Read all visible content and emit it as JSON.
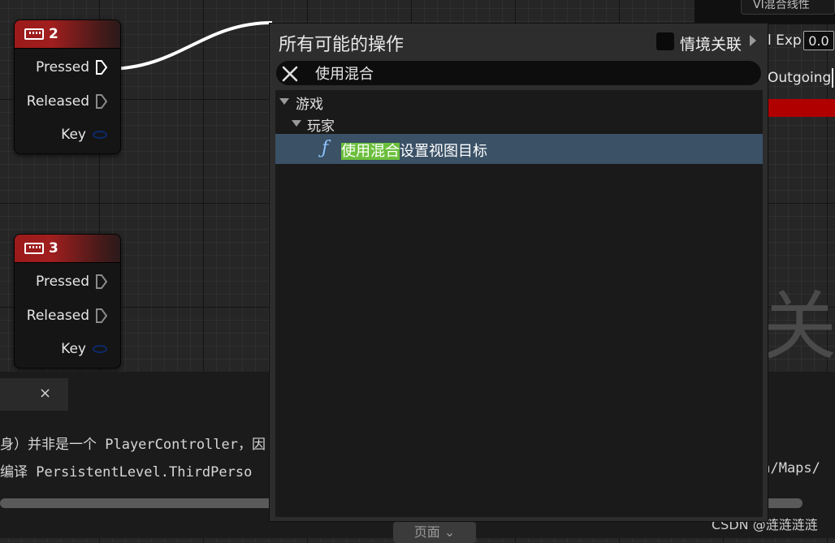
{
  "nodes": [
    {
      "title": "2",
      "pins": {
        "pressed": "Pressed",
        "released": "Released",
        "key": "Key"
      }
    },
    {
      "title": "3",
      "pins": {
        "pressed": "Pressed",
        "released": "Released",
        "key": "Key"
      }
    }
  ],
  "details_panel": {
    "top_button": "VI混合线性",
    "exp_label": "l Exp",
    "exp_value": "0.0",
    "outgoing_label": "Outgoing",
    "background_glyph": "关"
  },
  "output_log": {
    "tab_close_glyph": "×",
    "line1": "身）并非是一个 PlayerController，因",
    "line2": "编译 PersistentLevel.ThirdPerso",
    "line2_right": "on/Maps/",
    "page_button": "页面 ⌄"
  },
  "watermark": "CSDN @涟涟涟涟",
  "action_menu": {
    "title": "所有可能的操作",
    "context_label": "情境关联",
    "search_value": "使用混合",
    "categories": [
      {
        "label": "游戏"
      },
      {
        "label": "玩家"
      }
    ],
    "result": {
      "icon": "function-icon",
      "icon_glyph": "ƒ",
      "highlight": "使用混合",
      "rest": "设置视图目标"
    }
  },
  "colors": {
    "node_header": "#9b1a1a",
    "result_highlight": "#6bbf3c",
    "result_row": "#3a5166",
    "red_bar": "#b00000"
  }
}
